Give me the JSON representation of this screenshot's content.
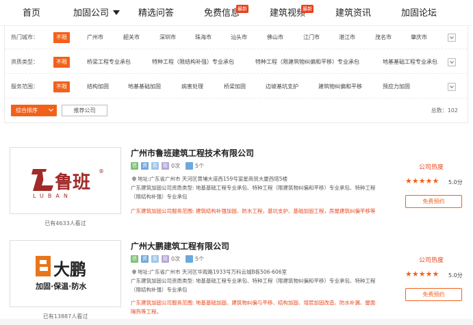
{
  "nav": {
    "items": [
      "首页",
      "加固公司",
      "精选问答",
      "免费信息",
      "建筑视频",
      "建筑资讯",
      "加固论坛"
    ],
    "badges": [
      "最新",
      "最新"
    ]
  },
  "filters": {
    "city": {
      "label": "热门城市：",
      "options": [
        "不限",
        "广州市",
        "韶关市",
        "深圳市",
        "珠海市",
        "汕头市",
        "佛山市",
        "江门市",
        "湛江市",
        "茂名市",
        "肇庆市"
      ]
    },
    "qualification": {
      "label": "资质类型：",
      "options": [
        "不限",
        "桥梁工程专业承包",
        "特种工程（限结构补强）专业承包",
        "特种工程（限建筑物纠偏和平移）专业承包",
        "地基基础工程专业承包"
      ]
    },
    "service": {
      "label": "服务范围：",
      "options": [
        "不限",
        "结构加固",
        "地基基础加固",
        "病害处理",
        "桥梁加固",
        "边坡基坑支护",
        "建筑物纠偏和平移",
        "预应力加固"
      ]
    }
  },
  "sort": {
    "primary_label": "综合排序",
    "secondary_label": "推荐公司",
    "total_text": "总数：102"
  },
  "companies": [
    {
      "name": "广州市鲁班建筑工程技术有限公司",
      "tags": [
        "信",
        "资",
        "实",
        "投"
      ],
      "cases": "0次",
      "projects": "5个",
      "address": "地址:广东省广州市 天河区黄埔大道西159号富星商贸大厦西塔5楼",
      "qualification": "广东建筑加固公司资质类型: 地基基础工程专业承包、特种工程（限建筑物纠偏和平移）专业承包、特种工程（限结构补强）专业承包",
      "scope": "广东建筑加固公司服务范围: 建筑结构补强加固、防水工程，基坑支护、基础加固工程，房屋建筑纠偏平移等",
      "heat_label": "公司热度",
      "rating": 5,
      "score_text": "5.0分",
      "appointment_label": "免费预约",
      "views_text": "已有4633人看过",
      "logo": {
        "text": "鲁班",
        "sub": "LUBAN",
        "mark": "®",
        "color": "#a12a2a"
      }
    },
    {
      "name": "广州大鹏建筑工程有限公司",
      "tags": [
        "信",
        "资",
        "实",
        "投"
      ],
      "cases": "0次",
      "projects": "5个",
      "address": "地址:广东省广州市 天河区华观路1933号万科云城B栋506-606室",
      "qualification": "广东建筑加固公司资质类型: 地基基础工程专业承包、特种工程（限建筑物纠偏和平移）专业承包、特种工程（限结构补强）专业承包",
      "scope": "广东建筑加固公司服务范围: 地基基础加固、建筑物纠偏与平移、结构加固、增层加固改造、防水补漏、屋面隔热等工程。",
      "heat_label": "公司热度",
      "rating": 5,
      "score_text": "5.0分",
      "appointment_label": "免费预约",
      "views_text": "已有13887人看过",
      "logo": {
        "text": "大鹏",
        "sub": "加固·保温·防水",
        "color": "#e8751a"
      }
    }
  ],
  "colors": {
    "accent": "#f2611a",
    "scope_red": "#e8461c",
    "badge_red": "#e9411b"
  }
}
